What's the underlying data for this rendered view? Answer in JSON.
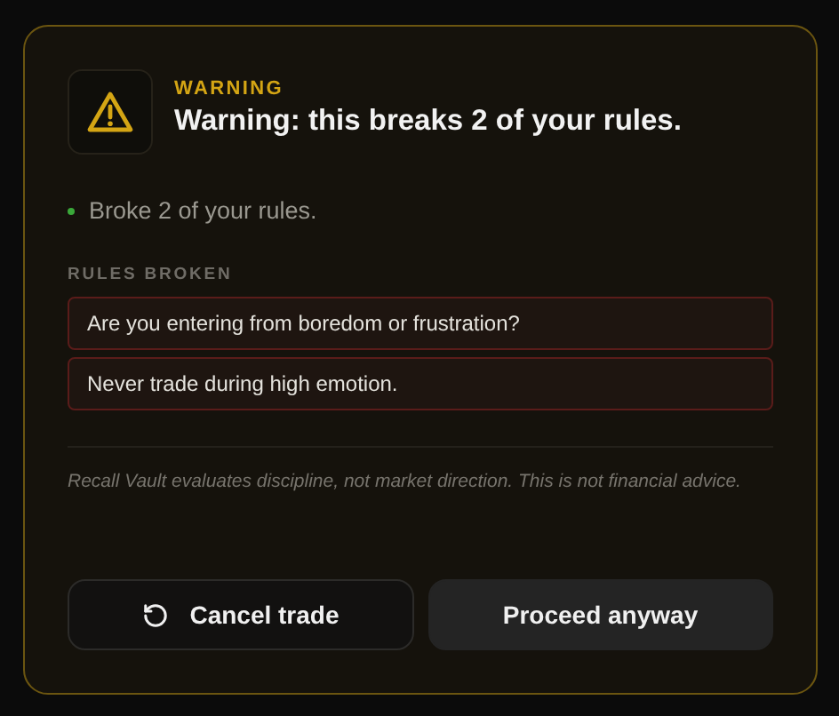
{
  "alert": {
    "eyebrow": "WARNING",
    "title": "Warning: this breaks 2 of your rules."
  },
  "status": "Broke 2 of your rules.",
  "rules": {
    "heading": "RULES BROKEN",
    "items": [
      {
        "text": "Are you entering from boredom or frustration?"
      },
      {
        "text": "Never trade during high emotion."
      }
    ]
  },
  "disclaimer": "Recall Vault evaluates discipline, not market direction. This is not financial advice.",
  "buttons": [
    {
      "kind": "secondary",
      "label": "Cancel trade"
    },
    {
      "kind": "primary",
      "label": "Proceed anyway"
    }
  ]
}
